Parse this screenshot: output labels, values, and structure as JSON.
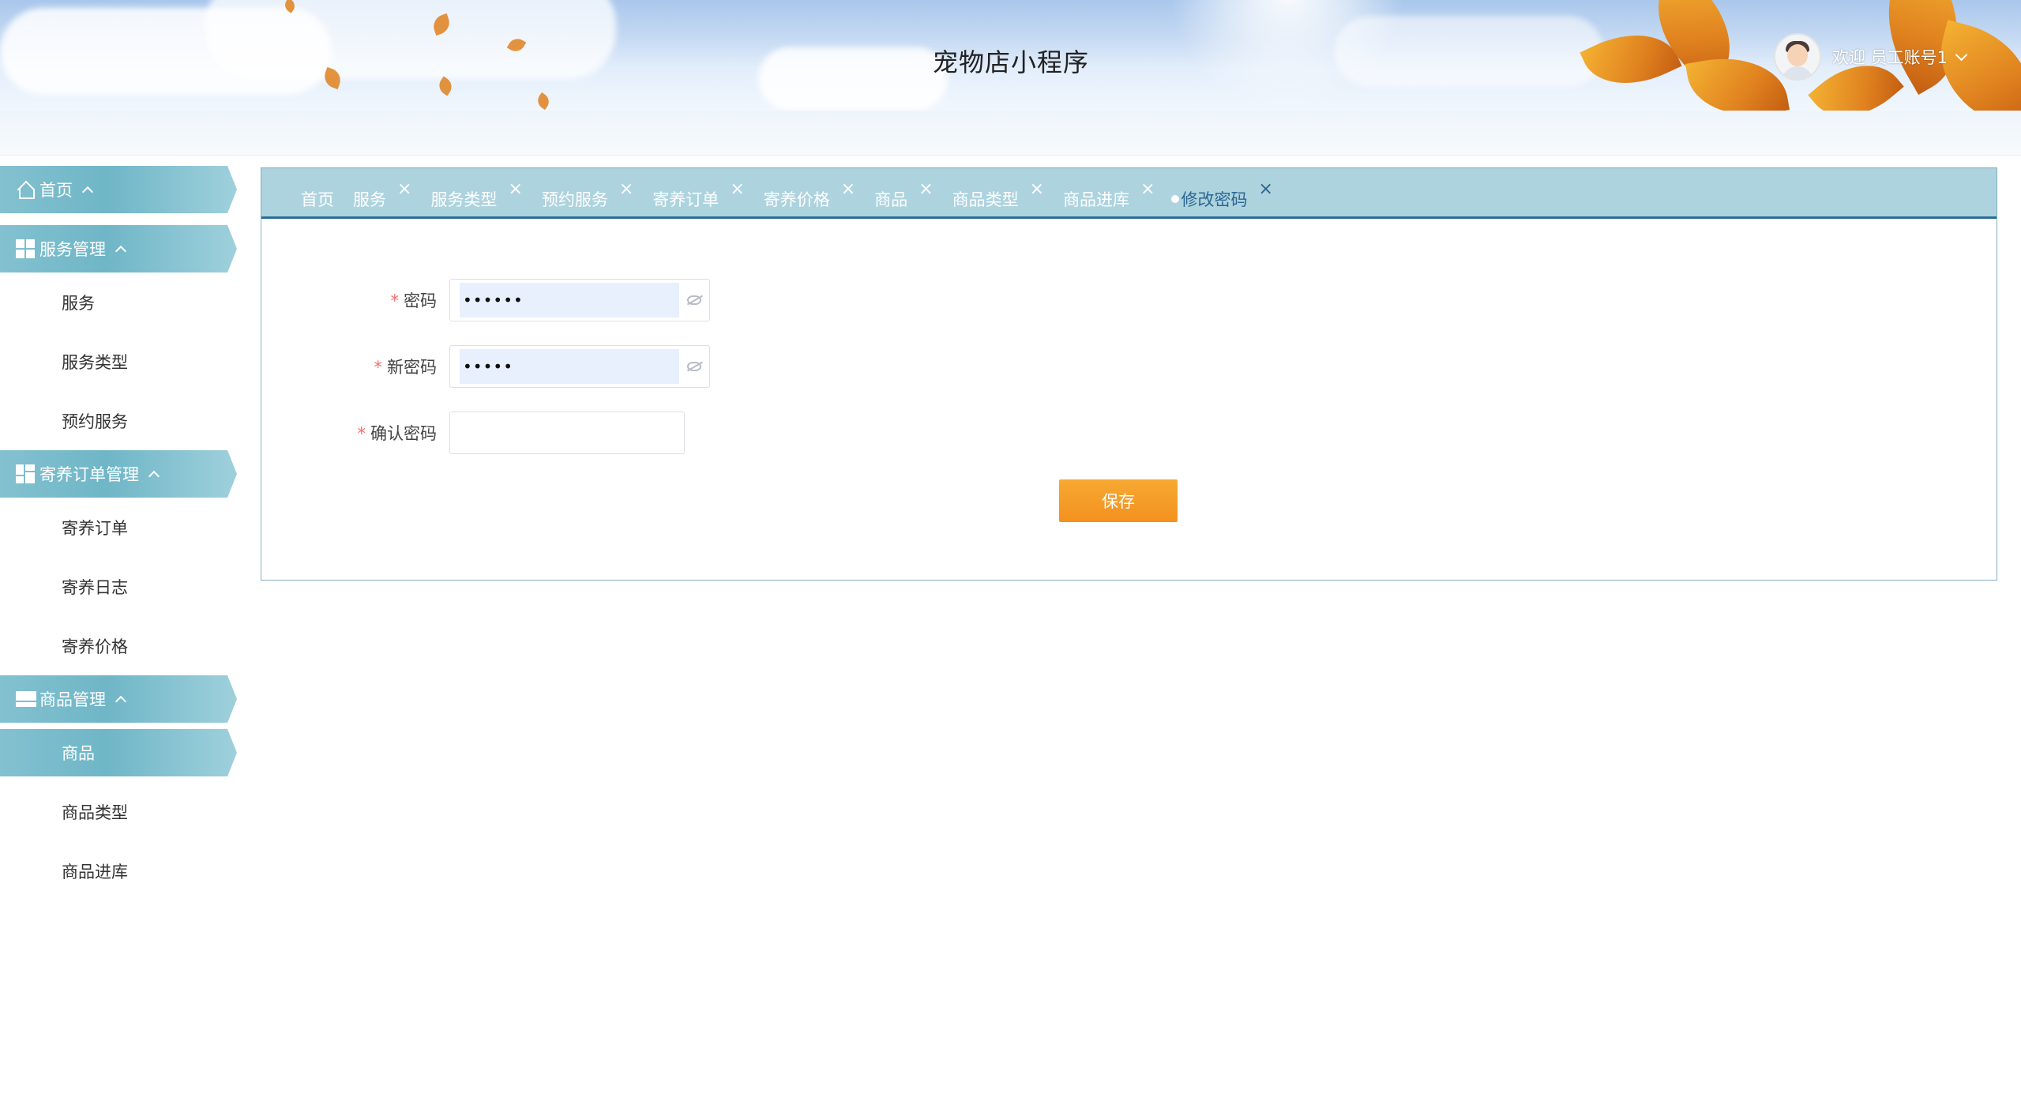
{
  "header": {
    "app_title": "宠物店小程序",
    "welcome_text": "欢迎 员工账号1"
  },
  "sidebar": {
    "groups": [
      {
        "label": "首页",
        "icon": "home-icon",
        "items": []
      },
      {
        "label": "服务管理",
        "icon": "grid-icon",
        "items": [
          {
            "label": "服务",
            "active": false
          },
          {
            "label": "服务类型",
            "active": false
          },
          {
            "label": "预约服务",
            "active": false
          }
        ]
      },
      {
        "label": "寄养订单管理",
        "icon": "dashboard-icon",
        "items": [
          {
            "label": "寄养订单",
            "active": false
          },
          {
            "label": "寄养日志",
            "active": false
          },
          {
            "label": "寄养价格",
            "active": false
          }
        ]
      },
      {
        "label": "商品管理",
        "icon": "list-icon",
        "items": [
          {
            "label": "商品",
            "active": true
          },
          {
            "label": "商品类型",
            "active": false
          },
          {
            "label": "商品进库",
            "active": false
          }
        ]
      }
    ]
  },
  "tabs": [
    {
      "label": "首页",
      "closable": false,
      "active": false
    },
    {
      "label": "服务",
      "closable": true,
      "active": false
    },
    {
      "label": "服务类型",
      "closable": true,
      "active": false
    },
    {
      "label": "预约服务",
      "closable": true,
      "active": false
    },
    {
      "label": "寄养订单",
      "closable": true,
      "active": false
    },
    {
      "label": "寄养价格",
      "closable": true,
      "active": false
    },
    {
      "label": "商品",
      "closable": true,
      "active": false
    },
    {
      "label": "商品类型",
      "closable": true,
      "active": false
    },
    {
      "label": "商品进库",
      "closable": true,
      "active": false
    },
    {
      "label": "修改密码",
      "closable": true,
      "active": true
    }
  ],
  "tab_close_glyph": "×",
  "form": {
    "required_mark": "*",
    "password": {
      "label": "密码",
      "value": "••••••"
    },
    "new_password": {
      "label": "新密码",
      "value": "•••••"
    },
    "confirm_password": {
      "label": "确认密码",
      "value": ""
    },
    "save_label": "保存"
  },
  "colors": {
    "accent": "#6fb6c7",
    "tab_bar": "#add3df",
    "tab_active_text": "#2b6590",
    "save_button": "#f3911e",
    "required": "#f56c6c"
  }
}
